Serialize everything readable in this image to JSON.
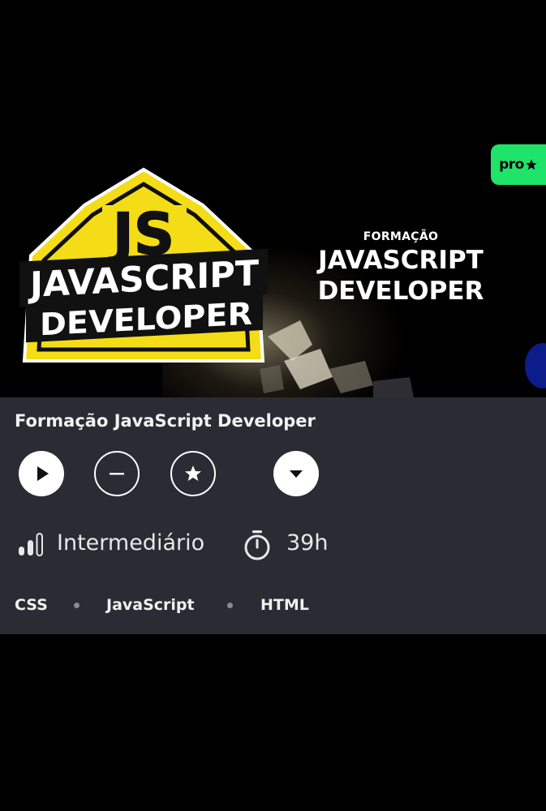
{
  "course": {
    "title": "Formação JavaScript Developer",
    "level": "Intermediário",
    "duration": "39h",
    "tags": [
      "CSS",
      "JavaScript",
      "HTML"
    ]
  },
  "hero": {
    "badge_label": "pro",
    "kicker": "FORMAÇÃO",
    "title_line1": "JAVASCRIPT",
    "title_line2": "DEVELOPER",
    "logo": {
      "badge_text": "JS",
      "line1": "JAVASCRIPT",
      "line2": "DEVELOPER"
    }
  },
  "actions": [
    {
      "name": "play-button",
      "icon": "play-icon"
    },
    {
      "name": "remove-button",
      "icon": "minus-icon"
    },
    {
      "name": "favorite-button",
      "icon": "star-icon"
    },
    {
      "name": "more-button",
      "icon": "chevron-down-icon"
    }
  ],
  "colors": {
    "background": "#000000",
    "panel": "#2a2b33",
    "pro_badge": "#20e36a",
    "logo_yellow": "#f4dd16",
    "text": "#f2f2f2",
    "dot": "#8a8b92"
  }
}
